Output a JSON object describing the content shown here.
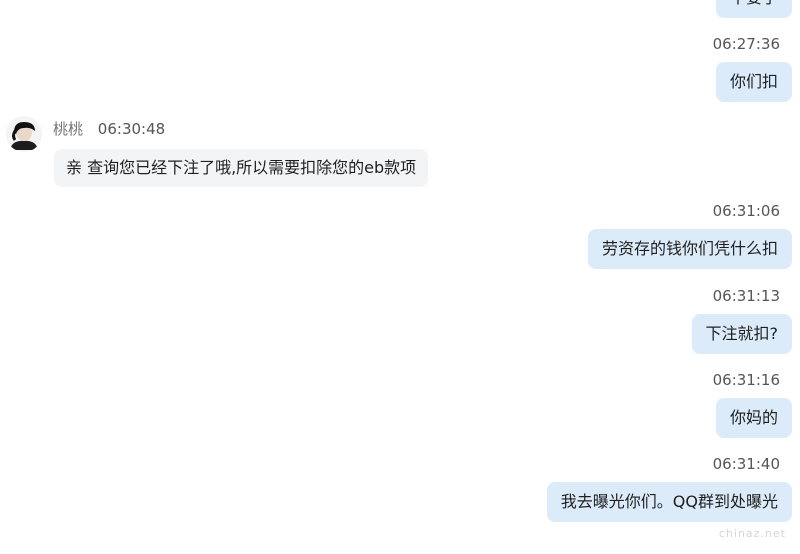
{
  "messages": [
    {
      "side": "right",
      "time": "",
      "text": "不要了"
    },
    {
      "side": "right",
      "time": "06:27:36",
      "text": "你们扣"
    },
    {
      "side": "left",
      "name": "桃桃",
      "time": "06:30:48",
      "text": "亲 查询您已经下注了哦,所以需要扣除您的eb款项"
    },
    {
      "side": "right",
      "time": "06:31:06",
      "text": "劳资存的钱你们凭什么扣"
    },
    {
      "side": "right",
      "time": "06:31:13",
      "text": "下注就扣?"
    },
    {
      "side": "right",
      "time": "06:31:16",
      "text": "你妈的"
    },
    {
      "side": "right",
      "time": "06:31:40",
      "text": "我去曝光你们。QQ群到处曝光"
    }
  ],
  "watermark": "chinaz.net",
  "colors": {
    "right_bubble": "#dcebf9",
    "left_bubble": "#f3f4f6",
    "time_text": "#555555",
    "name_text": "#777777"
  },
  "avatar": {
    "icon": "user-avatar-dark-hair"
  }
}
